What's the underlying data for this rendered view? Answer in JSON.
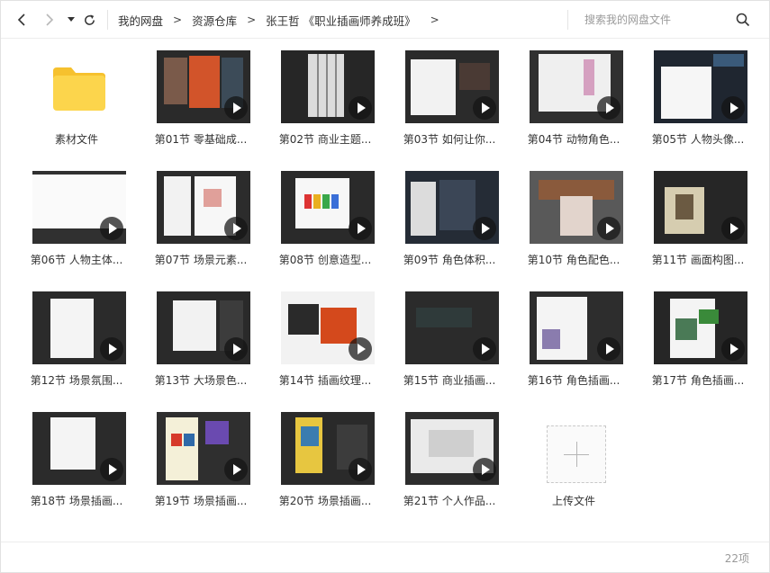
{
  "breadcrumb": {
    "items": [
      "我的网盘",
      "资源仓库",
      "张王哲 《职业插画师养成班》"
    ],
    "separator": ">"
  },
  "search": {
    "placeholder": "搜索我的网盘文件"
  },
  "files": [
    {
      "name": "素材文件",
      "type": "folder"
    },
    {
      "name": "第01节 零基础成...",
      "type": "video"
    },
    {
      "name": "第02节 商业主题...",
      "type": "video"
    },
    {
      "name": "第03节 如何让你...",
      "type": "video"
    },
    {
      "name": "第04节 动物角色...",
      "type": "video"
    },
    {
      "name": "第05节 人物头像...",
      "type": "video"
    },
    {
      "name": "第06节 人物主体...",
      "type": "video"
    },
    {
      "name": "第07节 场景元素...",
      "type": "video"
    },
    {
      "name": "第08节 创意造型...",
      "type": "video"
    },
    {
      "name": "第09节 角色体积...",
      "type": "video"
    },
    {
      "name": "第10节 角色配色...",
      "type": "video"
    },
    {
      "name": "第11节 画面构图...",
      "type": "video"
    },
    {
      "name": "第12节 场景氛围...",
      "type": "video"
    },
    {
      "name": "第13节 大场景色...",
      "type": "video"
    },
    {
      "name": "第14节 插画纹理...",
      "type": "video"
    },
    {
      "name": "第15节 商业插画...",
      "type": "video"
    },
    {
      "name": "第16节 角色插画...",
      "type": "video"
    },
    {
      "name": "第17节 角色插画...",
      "type": "video"
    },
    {
      "name": "第18节 场景插画...",
      "type": "video"
    },
    {
      "name": "第19节 场景插画...",
      "type": "video"
    },
    {
      "name": "第20节 场景插画...",
      "type": "video"
    },
    {
      "name": "第21节 个人作品...",
      "type": "video"
    },
    {
      "name": "上传文件",
      "type": "upload"
    }
  ],
  "footer": {
    "count_label": "22项"
  },
  "colors": {
    "folder": "#fcd54c",
    "folder_tab": "#f6c12e",
    "accent_text": "#333333"
  }
}
